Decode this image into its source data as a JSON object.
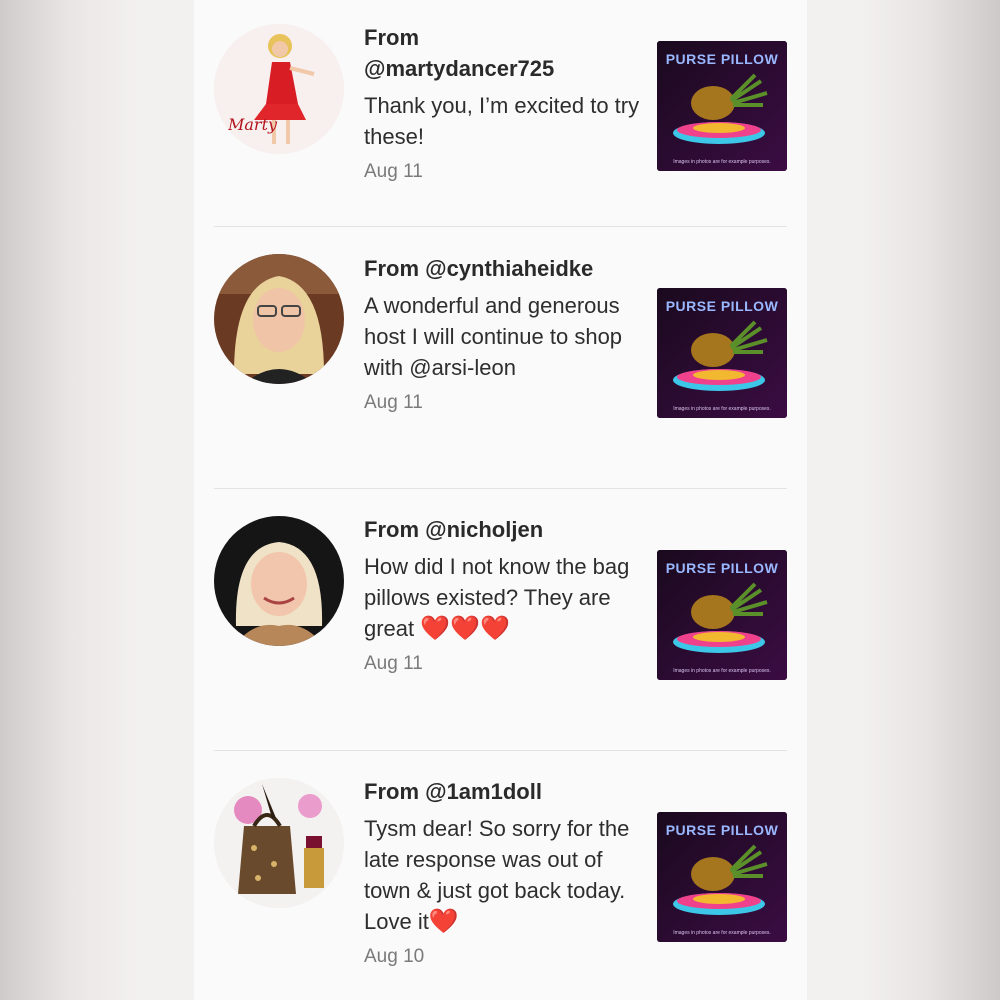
{
  "product": {
    "title": "PURSE PILLOW",
    "note": "Images in photos are for example purposes."
  },
  "reviews": [
    {
      "from": "From @martydancer725",
      "from_line1": "From",
      "from_line2": "@martydancer725",
      "message": "Thank you, I’m excited to try these!",
      "date": "Aug 11",
      "avatar_label": "Marty",
      "avatar_icon": "cartoon-dancer-avatar"
    },
    {
      "from": "From @cynthiaheidke",
      "message": "A wonderful and generous host I will continue to shop with @arsi-leon",
      "date": "Aug 11",
      "avatar_icon": "blonde-woman-glasses-avatar"
    },
    {
      "from": "From @nicholjen",
      "message_text": "How did I not know the bag pillows existed? They are great",
      "message_hearts": "❤️❤️❤️",
      "date": "Aug 11",
      "avatar_icon": "smiling-woman-avatar"
    },
    {
      "from": "From @1am1doll",
      "message_text": "Tysm dear! So sorry for the late response was out of town & just got back today. Love it",
      "message_hearts": "❤️",
      "date": "Aug 10",
      "avatar_icon": "handbag-lipstick-avatar"
    }
  ],
  "colors": {
    "heart": "#e0191c",
    "thumb_bg": "#1a0a1e",
    "thumb_title": "#9ab8ff",
    "divider": "#e3e3e3"
  }
}
